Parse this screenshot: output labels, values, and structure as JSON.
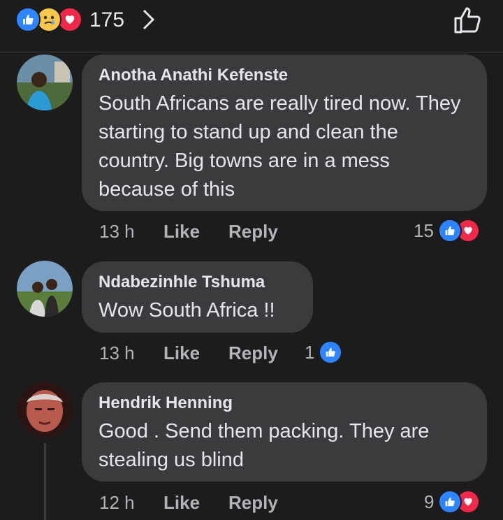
{
  "header": {
    "reaction_count": "175",
    "reactions": [
      "like-icon",
      "sad-icon",
      "love-icon"
    ]
  },
  "comments": [
    {
      "author": "Anotha Anathi Kefenste",
      "text": "South Africans are really tired now. They starting to stand up and clean the country. Big towns are in a mess because of this",
      "time": "13 h",
      "like_label": "Like",
      "reply_label": "Reply",
      "reaction_count": "15",
      "reactions": [
        "like-icon",
        "love-icon"
      ]
    },
    {
      "author": "Ndabezinhle Tshuma",
      "text": "Wow South Africa !!",
      "time": "13 h",
      "like_label": "Like",
      "reply_label": "Reply",
      "reaction_count": "1",
      "reactions": [
        "like-icon"
      ]
    },
    {
      "author": "Hendrik Henning",
      "text": "Good . Send them packing. They are stealing us blind",
      "time": "12 h",
      "like_label": "Like",
      "reply_label": "Reply",
      "reaction_count": "9",
      "reactions": [
        "like-icon",
        "love-icon"
      ]
    }
  ],
  "colors": {
    "background": "#1c1c1d",
    "bubble": "#3a3b3c",
    "like_blue": "#2d86ff",
    "love_red": "#f0284a",
    "meta_gray": "#b0b3b8"
  }
}
